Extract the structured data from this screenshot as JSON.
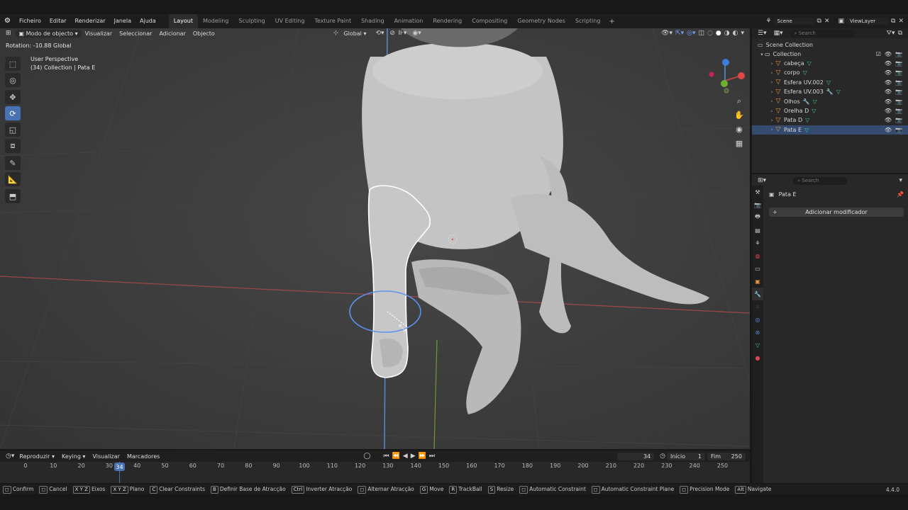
{
  "topbar": {
    "menus": [
      "Ficheiro",
      "Editar",
      "Renderizar",
      "Janela",
      "Ajuda"
    ],
    "workspaces": [
      "Layout",
      "Modeling",
      "Sculpting",
      "UV Editing",
      "Texture Paint",
      "Shading",
      "Animation",
      "Rendering",
      "Compositing",
      "Geometry Nodes",
      "Scripting"
    ],
    "active_workspace": "Layout",
    "scene_label": "Scene",
    "viewlayer_label": "ViewLayer"
  },
  "viewport": {
    "mode": "Modo de objecto",
    "menus": [
      "Visualizar",
      "Seleccionar",
      "Adicionar",
      "Objecto"
    ],
    "orientation": "Global",
    "operator_text": "Rotation: -10.88 Global",
    "perspective": "User Perspective",
    "context": "(34) Collection | Pata E"
  },
  "outliner": {
    "search_placeholder": "Search",
    "scene_collection": "Scene Collection",
    "collection": "Collection",
    "items": [
      {
        "name": "cabeça",
        "selected": false
      },
      {
        "name": "corpo",
        "selected": false
      },
      {
        "name": "Esfera UV.002",
        "selected": false
      },
      {
        "name": "Esfera UV.003",
        "selected": false
      },
      {
        "name": "Olhos",
        "selected": false
      },
      {
        "name": "Orelha D",
        "selected": false
      },
      {
        "name": "Pata D",
        "selected": false
      },
      {
        "name": "Pata E",
        "selected": true
      }
    ]
  },
  "properties": {
    "search_placeholder": "Search",
    "object_name": "Pata E",
    "add_modifier": "Adicionar modificador"
  },
  "timeline": {
    "menus": [
      "Reproduzir",
      "Keying",
      "Visualizar",
      "Marcadores"
    ],
    "current_frame": "34",
    "start_label": "Início",
    "start_value": "1",
    "end_label": "Fim",
    "end_value": "250",
    "ticks": [
      "0",
      "10",
      "20",
      "30",
      "40",
      "50",
      "60",
      "70",
      "80",
      "90",
      "100",
      "110",
      "120",
      "130",
      "140",
      "150",
      "160",
      "170",
      "180",
      "190",
      "200",
      "210",
      "220",
      "230",
      "240",
      "250"
    ]
  },
  "statusbar": {
    "items": [
      {
        "key": "",
        "label": "Confirm"
      },
      {
        "key": "",
        "label": "Cancel"
      },
      {
        "key": "X Y Z",
        "label": "Eixos"
      },
      {
        "key": "X Y Z",
        "label": "Plano"
      },
      {
        "key": "C",
        "label": "Clear Constraints"
      },
      {
        "key": "B",
        "label": "Definir Base de Atracção"
      },
      {
        "key": "Ctrl",
        "label": "Inverter Atracção"
      },
      {
        "key": "",
        "label": "Alternar Atracção"
      },
      {
        "key": "G",
        "label": "Move"
      },
      {
        "key": "R",
        "label": "TrackBall"
      },
      {
        "key": "S",
        "label": "Resize"
      },
      {
        "key": "",
        "label": "Automatic Constraint"
      },
      {
        "key": "",
        "label": "Automatic Constraint Plane"
      },
      {
        "key": "",
        "label": "Precision Mode"
      },
      {
        "key": "Alt",
        "label": "Navigate"
      }
    ],
    "version": "4.4.0"
  },
  "colors": {
    "accent": "#4772b3",
    "selection_outline": "#ffffff",
    "x_axis": "#a04848",
    "z_axis": "#5a8fd8",
    "y_axis": "#6f9a35"
  }
}
